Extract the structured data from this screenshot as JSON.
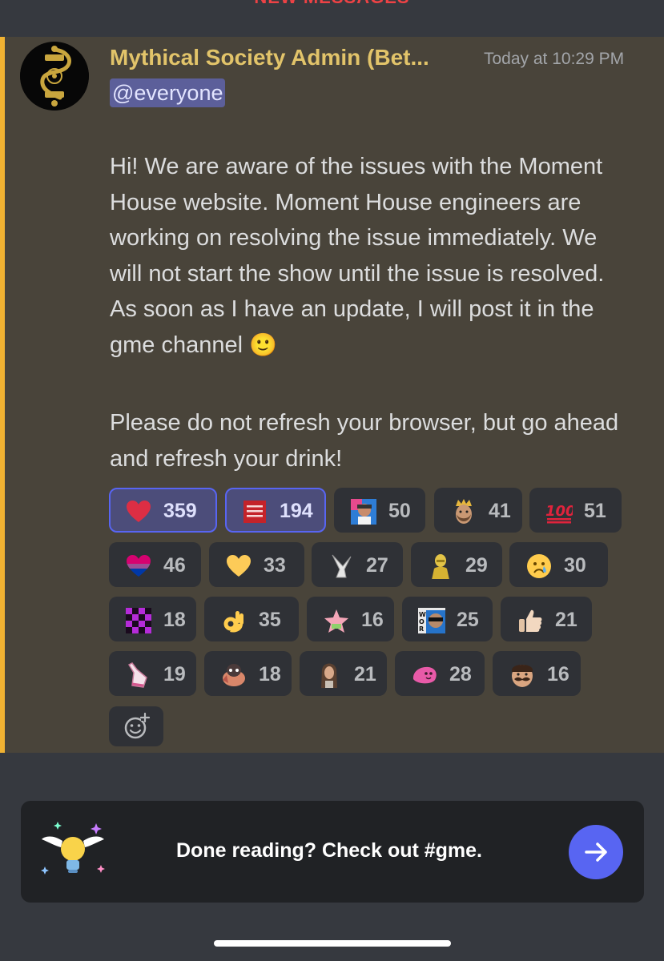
{
  "banner": {
    "label": "NEW MESSAGES"
  },
  "message": {
    "author": "Mythical Society Admin (Bet...",
    "timestamp": "Today at 10:29 PM",
    "mention": "@everyone",
    "paragraph1": "Hi! We are aware of the issues with the Moment House website. Moment House engineers are working on resolving the issue immediately. We will not start the show until the issue is resolved. As soon as I have an update, I will post it in the gme channel",
    "paragraph1_emoji": "🙂",
    "paragraph2": "Please do not refresh your browser, but go ahead and refresh your drink!"
  },
  "reactions": [
    {
      "emoji": "red-heart",
      "count": "359",
      "selected": true
    },
    {
      "emoji": "were-still-good-sign",
      "count": "194",
      "selected": true
    },
    {
      "emoji": "person-sticker",
      "count": "50",
      "selected": false
    },
    {
      "emoji": "crowned-man",
      "count": "41",
      "selected": false
    },
    {
      "emoji": "hundred-points",
      "count": "51",
      "selected": false
    },
    {
      "emoji": "bi-pride-heart",
      "count": "46",
      "selected": false
    },
    {
      "emoji": "yellow-heart",
      "count": "33",
      "selected": false
    },
    {
      "emoji": "white-horns",
      "count": "27",
      "selected": false
    },
    {
      "emoji": "golden-statue",
      "count": "29",
      "selected": false
    },
    {
      "emoji": "crying-face",
      "count": "30",
      "selected": false
    },
    {
      "emoji": "purple-checker",
      "count": "18",
      "selected": false
    },
    {
      "emoji": "ok-hand",
      "count": "35",
      "selected": false
    },
    {
      "emoji": "patrick-star",
      "count": "16",
      "selected": false
    },
    {
      "emoji": "word-sunglasses",
      "count": "25",
      "selected": false
    },
    {
      "emoji": "thumbs-up",
      "count": "21",
      "selected": false
    },
    {
      "emoji": "pointing-hand",
      "count": "19",
      "selected": false
    },
    {
      "emoji": "cartoon-bird",
      "count": "18",
      "selected": false
    },
    {
      "emoji": "long-hair-person",
      "count": "21",
      "selected": false
    },
    {
      "emoji": "pink-blob",
      "count": "28",
      "selected": false
    },
    {
      "emoji": "mustache-man",
      "count": "16",
      "selected": false
    }
  ],
  "add_reaction": {
    "icon": "add-reaction-icon"
  },
  "footer_card": {
    "text": "Done reading? Check out #gme.",
    "icon": "winged-lightbulb-icon",
    "button_icon": "arrow-right-icon"
  },
  "colors": {
    "background": "#36393f",
    "mention_highlight": "#49443a",
    "mention_bar": "#f0b232",
    "username": "#e2c46a",
    "brand": "#5865f2"
  }
}
